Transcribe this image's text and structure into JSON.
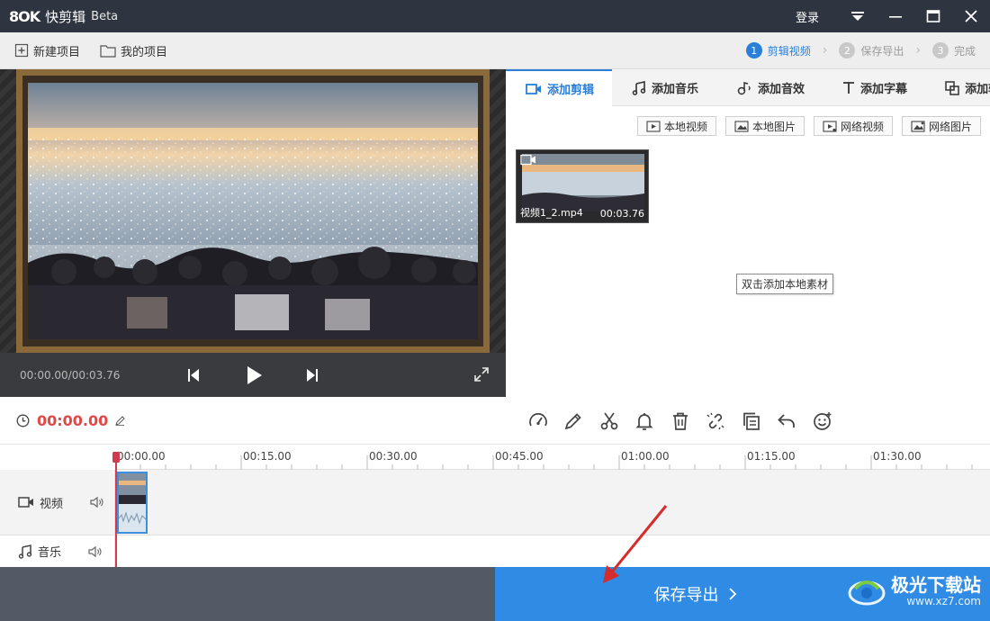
{
  "app": {
    "logo_text": "8OK",
    "title": "快剪辑",
    "beta": "Beta",
    "login": "登录"
  },
  "toolbar": {
    "new_project": "新建项目",
    "my_projects": "我的项目"
  },
  "steps": [
    {
      "num": "1",
      "label": "剪辑视频",
      "active": true
    },
    {
      "num": "2",
      "label": "保存导出",
      "active": false
    },
    {
      "num": "3",
      "label": "完成",
      "active": false
    }
  ],
  "player": {
    "time": "00:00.00/00:03.76"
  },
  "media_tabs": [
    {
      "label": "添加剪辑",
      "icon": "video-camera-icon",
      "active": true
    },
    {
      "label": "添加音乐",
      "icon": "music-note-icon",
      "active": false
    },
    {
      "label": "添加音效",
      "icon": "sound-effect-icon",
      "active": false
    },
    {
      "label": "添加字幕",
      "icon": "text-t-icon",
      "active": false
    },
    {
      "label": "添加转场",
      "icon": "transition-icon",
      "active": false
    }
  ],
  "source_buttons": [
    "本地视频",
    "本地图片",
    "网络视频",
    "网络图片"
  ],
  "media_item": {
    "name": "视频1_2.mp4",
    "duration": "00:03.76"
  },
  "tooltip": "双击添加本地素材",
  "edit_bar": {
    "current_time": "00:00.00",
    "tools": [
      "speed-icon",
      "pen-icon",
      "scissors-icon",
      "bell-icon",
      "trash-icon",
      "unlink-icon",
      "copy-icon",
      "undo-icon",
      "emoji-icon"
    ]
  },
  "timeline": {
    "ticks": [
      "00:00.00",
      "00:15.00",
      "00:30.00",
      "00:45.00",
      "01:00.00",
      "01:15.00",
      "01:30.00"
    ],
    "tracks": [
      {
        "label": "视频",
        "icon": "video-camera-icon"
      },
      {
        "label": "音乐",
        "icon": "music-note-icon"
      }
    ]
  },
  "export": {
    "label": "保存导出"
  },
  "watermark": {
    "text": "极光下载站",
    "url": "www.xz7.com"
  },
  "colors": {
    "accent": "#2a7fd8",
    "export_bg": "#2f8be3",
    "time_red": "#e04848",
    "title_bar": "#2f3540"
  }
}
